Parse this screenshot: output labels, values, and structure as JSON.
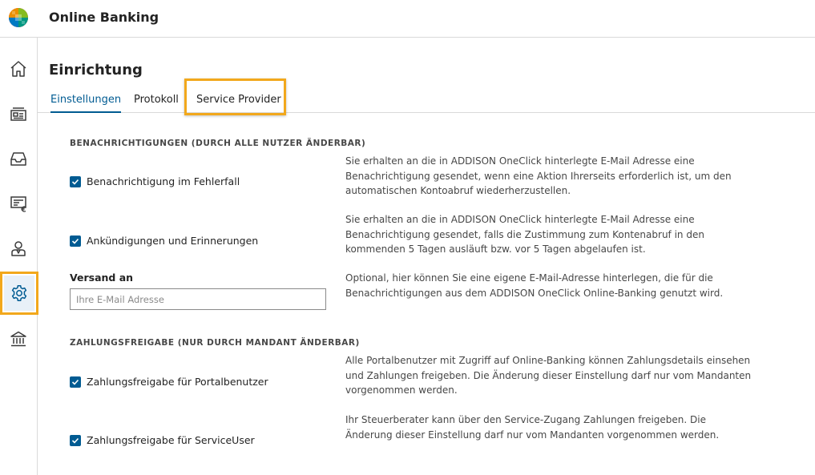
{
  "app": {
    "title": "Online Banking",
    "logo_icon": "bank-logo-icon"
  },
  "sidebar": {
    "items": [
      {
        "name": "home",
        "icon": "home-icon",
        "active": false
      },
      {
        "name": "accounts",
        "icon": "account-card-icon",
        "active": false
      },
      {
        "name": "inbox",
        "icon": "inbox-icon",
        "active": false
      },
      {
        "name": "payments",
        "icon": "euro-document-icon",
        "active": false
      },
      {
        "name": "users",
        "icon": "user-icon",
        "active": false
      },
      {
        "name": "settings",
        "icon": "gear-icon",
        "active": true
      },
      {
        "name": "banks",
        "icon": "bank-building-icon",
        "active": false
      }
    ]
  },
  "page": {
    "title": "Einrichtung",
    "tabs": [
      {
        "label": "Einstellungen",
        "active": true
      },
      {
        "label": "Protokoll",
        "active": false
      },
      {
        "label": "Service Provider",
        "active": false,
        "highlighted": true
      }
    ]
  },
  "notifications": {
    "heading": "BENACHRICHTIGUNGEN (DURCH ALLE NUTZER ÄNDERBAR)",
    "items": [
      {
        "label": "Benachrichtigung im Fehlerfall",
        "checked": true,
        "description": "Sie erhalten an die in ADDISON OneClick hinterlegte E-Mail Adresse eine Benachrichtigung gesendet, wenn eine Aktion Ihrerseits erforderlich ist, um den automatischen Kontoabruf wiederherzustellen."
      },
      {
        "label": "Ankündigungen und Erinnerungen",
        "checked": true,
        "description": "Sie erhalten an die in ADDISON OneClick hinterlegte E-Mail Adresse eine Benachrichtigung gesendet, falls die Zustimmung zum Kontenabruf in den kommenden 5 Tagen ausläuft bzw. vor 5 Tagen abgelaufen ist."
      }
    ],
    "send_to": {
      "label": "Versand an",
      "value": "",
      "placeholder": "Ihre E-Mail Adresse",
      "description": "Optional, hier können Sie eine eigene E-Mail-Adresse hinterlegen, die für die Benachrichtigungen aus dem ADDISON OneClick Online-Banking genutzt wird."
    }
  },
  "payment_release": {
    "heading": "ZAHLUNGSFREIGABE (NUR DURCH MANDANT ÄNDERBAR)",
    "items": [
      {
        "label": "Zahlungsfreigabe für Portalbenutzer",
        "checked": true,
        "description": "Alle Portalbenutzer mit Zugriff auf Online-Banking können Zahlungsdetails einsehen und Zahlungen freigeben. Die Änderung dieser Einstellung darf nur vom Mandanten vorgenommen werden."
      },
      {
        "label": "Zahlungsfreigabe für ServiceUser",
        "checked": true,
        "description": "Ihr Steuerberater kann über den Service-Zugang Zahlungen freigeben. Die Änderung dieser Einstellung darf nur vom Mandanten vorgenommen werden."
      }
    ]
  },
  "colors": {
    "accent": "#005b92",
    "highlight": "#f2a81c",
    "border": "#dadada"
  }
}
